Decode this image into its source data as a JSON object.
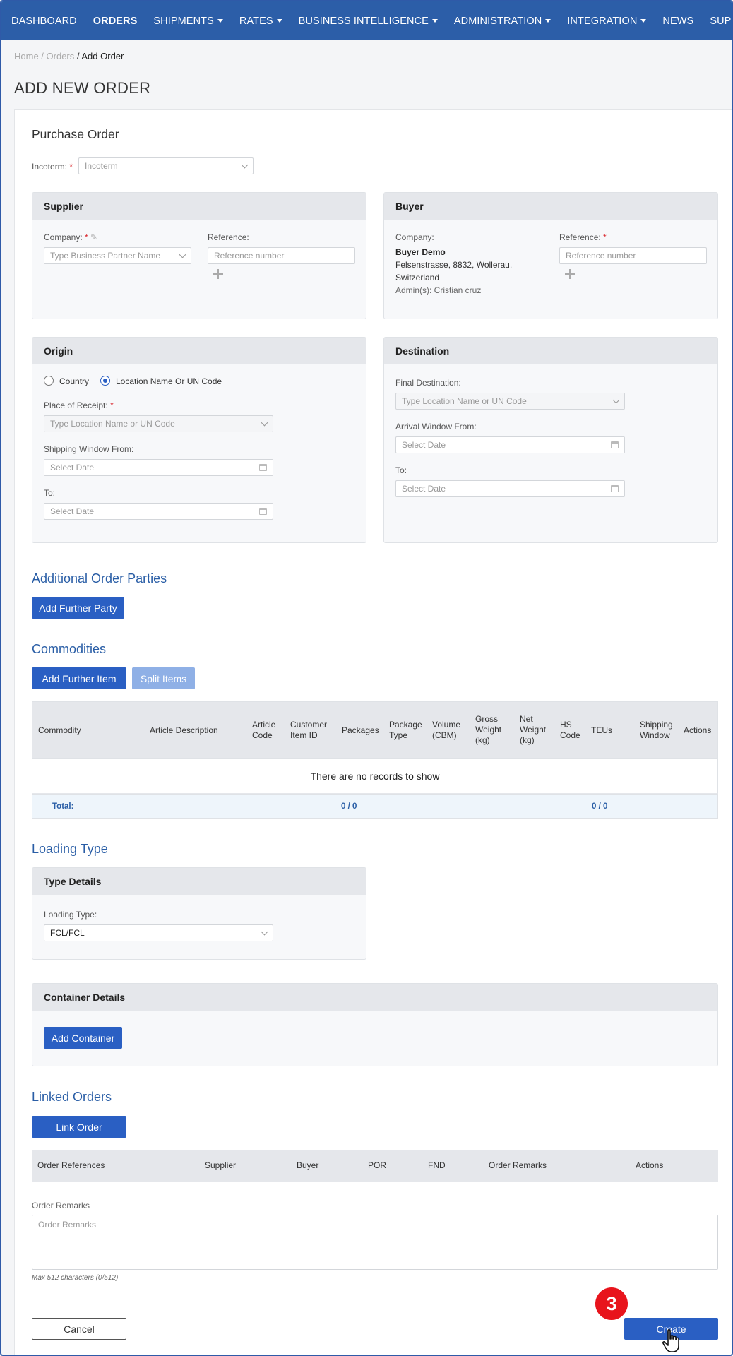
{
  "nav": {
    "items": [
      {
        "label": "DASHBOARD",
        "caret": false,
        "active": false
      },
      {
        "label": "ORDERS",
        "caret": false,
        "active": true
      },
      {
        "label": "SHIPMENTS",
        "caret": true,
        "active": false
      },
      {
        "label": "RATES",
        "caret": true,
        "active": false
      },
      {
        "label": "BUSINESS INTELLIGENCE",
        "caret": true,
        "active": false
      },
      {
        "label": "ADMINISTRATION",
        "caret": true,
        "active": false
      },
      {
        "label": "INTEGRATION",
        "caret": true,
        "active": false
      },
      {
        "label": "NEWS",
        "caret": false,
        "active": false
      },
      {
        "label": "SUPPORT CENTER",
        "caret": false,
        "active": false
      }
    ]
  },
  "breadcrumb": {
    "home": "Home",
    "sep1": " / ",
    "orders": "Orders",
    "sep2": " / ",
    "current": "Add Order"
  },
  "page_title": "ADD NEW ORDER",
  "purchase_order": {
    "title": "Purchase Order",
    "incoterm_label": "Incoterm:",
    "incoterm_placeholder": "Incoterm"
  },
  "supplier": {
    "title": "Supplier",
    "company_label": "Company:",
    "company_placeholder": "Type Business Partner Name",
    "reference_label": "Reference:",
    "reference_placeholder": "Reference number"
  },
  "buyer": {
    "title": "Buyer",
    "company_label": "Company:",
    "company_name": "Buyer Demo",
    "address_line1": "Felsenstrasse, 8832, Wollerau,",
    "address_line2": "Switzerland",
    "admins": "Admin(s): Cristian cruz",
    "reference_label": "Reference:",
    "reference_placeholder": "Reference number"
  },
  "origin": {
    "title": "Origin",
    "radio_country": "Country",
    "radio_location": "Location Name Or UN Code",
    "place_label": "Place of Receipt:",
    "place_placeholder": "Type Location Name or UN Code",
    "window_from_label": "Shipping Window From:",
    "date_placeholder": "Select Date",
    "to_label": "To:"
  },
  "destination": {
    "title": "Destination",
    "final_label": "Final Destination:",
    "final_placeholder": "Type Location Name or UN Code",
    "arrival_label": "Arrival Window From:",
    "date_placeholder": "Select Date",
    "to_label": "To:"
  },
  "parties": {
    "title": "Additional Order Parties",
    "add_button": "Add Further Party"
  },
  "commodities": {
    "title": "Commodities",
    "add_button": "Add Further Item",
    "split_button": "Split Items",
    "columns": [
      "Commodity",
      "Article Description",
      "Article Code",
      "Customer Item ID",
      "Packages",
      "Package Type",
      "Volume (CBM)",
      "Gross Weight (kg)",
      "Net Weight (kg)",
      "HS Code",
      "TEUs",
      "Shipping Window",
      "Actions"
    ],
    "empty": "There are no records to show",
    "total_label": "Total:",
    "total_packages": "0 / 0",
    "total_teus": "0 / 0"
  },
  "loading": {
    "title": "Loading Type",
    "panel_title": "Type Details",
    "type_label": "Loading Type:",
    "type_value": "FCL/FCL"
  },
  "container": {
    "title": "Container Details",
    "add_button": "Add Container"
  },
  "linked": {
    "title": "Linked Orders",
    "link_button": "Link Order",
    "columns": [
      "Order References",
      "Supplier",
      "Buyer",
      "POR",
      "FND",
      "Order Remarks",
      "Actions"
    ]
  },
  "remarks": {
    "label": "Order Remarks",
    "placeholder": "Order Remarks",
    "hint": "Max 512 characters (0/512)"
  },
  "footer": {
    "cancel": "Cancel",
    "create": "Create",
    "step_badge": "3"
  },
  "colors": {
    "nav": "#2c5ea8",
    "primary_button": "#2a5fc3",
    "section_title": "#2a5ea6",
    "required": "#d9262c",
    "badge": "#e8141c"
  }
}
